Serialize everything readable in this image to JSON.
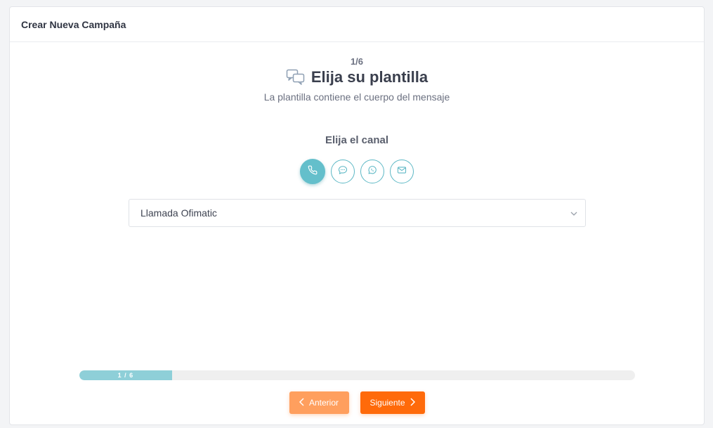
{
  "header": {
    "title": "Crear Nueva Campaña"
  },
  "step": {
    "counter": "1/6",
    "title": "Elija su plantilla",
    "subtitle": "La plantilla contiene el cuerpo del mensaje",
    "icon": "chat-bubbles-icon"
  },
  "channel": {
    "label": "Elija el canal",
    "options": [
      {
        "icon": "phone-icon",
        "selected": true
      },
      {
        "icon": "sms-icon",
        "selected": false
      },
      {
        "icon": "whatsapp-icon",
        "selected": false
      },
      {
        "icon": "email-icon",
        "selected": false
      }
    ]
  },
  "template_select": {
    "value": "Llamada Ofimatic"
  },
  "progress": {
    "label": "1 / 6",
    "current": 1,
    "total": 6
  },
  "buttons": {
    "prev_label": "Anterior",
    "next_label": "Siguiente"
  },
  "colors": {
    "accent_teal": "#64bfcb",
    "progress_fill": "#8ecfd8",
    "prev_button": "#ff9f5e",
    "next_button": "#ff6a0a"
  }
}
